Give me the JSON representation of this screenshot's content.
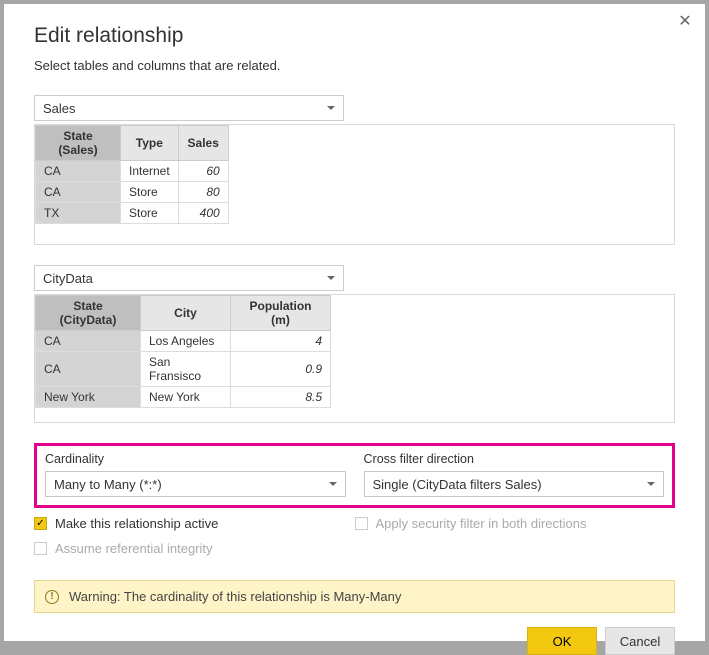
{
  "dialog": {
    "title": "Edit relationship",
    "subtitle": "Select tables and columns that are related."
  },
  "table1": {
    "name": "Sales",
    "columns": [
      "State (Sales)",
      "Type",
      "Sales"
    ],
    "selected_col_index": 0,
    "rows": [
      {
        "c0": "CA",
        "c1": "Internet",
        "c2": "60"
      },
      {
        "c0": "CA",
        "c1": "Store",
        "c2": "80"
      },
      {
        "c0": "TX",
        "c1": "Store",
        "c2": "400"
      }
    ]
  },
  "table2": {
    "name": "CityData",
    "columns": [
      "State (CityData)",
      "City",
      "Population (m)"
    ],
    "selected_col_index": 0,
    "rows": [
      {
        "c0": "CA",
        "c1": "Los Angeles",
        "c2": "4"
      },
      {
        "c0": "CA",
        "c1": "San Fransisco",
        "c2": "0.9"
      },
      {
        "c0": "New York",
        "c1": "New York",
        "c2": "8.5"
      }
    ]
  },
  "cardinality": {
    "label": "Cardinality",
    "value": "Many to Many (*:*)"
  },
  "crossfilter": {
    "label": "Cross filter direction",
    "value": "Single (CityData filters Sales)"
  },
  "checks": {
    "active_label": "Make this relationship active",
    "security_label": "Apply security filter in both directions",
    "ref_integrity_label": "Assume referential integrity"
  },
  "warning": "Warning: The cardinality of this relationship is Many-Many",
  "buttons": {
    "ok": "OK",
    "cancel": "Cancel"
  }
}
